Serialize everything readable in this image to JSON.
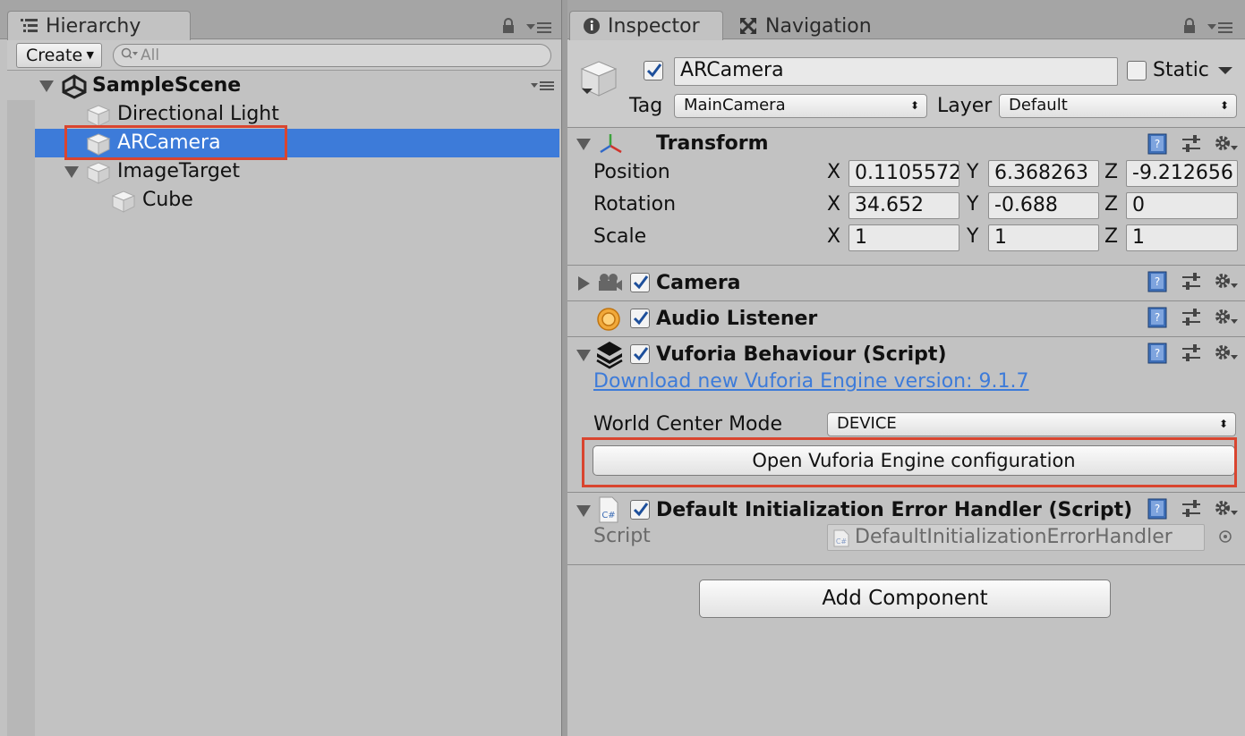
{
  "hierarchy": {
    "tab_label": "Hierarchy",
    "create_label": "Create",
    "search_placeholder": "All",
    "scene_name": "SampleScene",
    "items": [
      {
        "label": "Directional Light"
      },
      {
        "label": "ARCamera"
      },
      {
        "label": "ImageTarget"
      },
      {
        "label": "Cube"
      }
    ]
  },
  "inspector": {
    "tab_label": "Inspector",
    "nav_tab_label": "Navigation",
    "object_name": "ARCamera",
    "static_label": "Static",
    "tag_label": "Tag",
    "tag_value": "MainCamera",
    "layer_label": "Layer",
    "layer_value": "Default",
    "transform": {
      "title": "Transform",
      "position_label": "Position",
      "rotation_label": "Rotation",
      "scale_label": "Scale",
      "x": "X",
      "y": "Y",
      "z": "Z",
      "position": [
        "0.1105572",
        "6.368263",
        "-9.212656"
      ],
      "rotation": [
        "34.652",
        "-0.688",
        "0"
      ],
      "scale": [
        "1",
        "1",
        "1"
      ]
    },
    "camera_title": "Camera",
    "audio_title": "Audio Listener",
    "vuforia": {
      "title": "Vuforia Behaviour (Script)",
      "download_link": "Download new Vuforia Engine version: 9.1.7",
      "world_center_label": "World Center Mode",
      "world_center_value": "DEVICE",
      "config_button": "Open Vuforia Engine configuration"
    },
    "error_handler": {
      "title": "Default Initialization Error Handler (Script)",
      "script_label": "Script",
      "script_value": "DefaultInitializationErrorHandler",
      "cs_icon_text": "C#"
    },
    "add_component": "Add Component"
  },
  "colors": {
    "selection": "#3d7bd9",
    "highlight_box": "#d9452f",
    "panel_bg": "#c2c2c2"
  }
}
